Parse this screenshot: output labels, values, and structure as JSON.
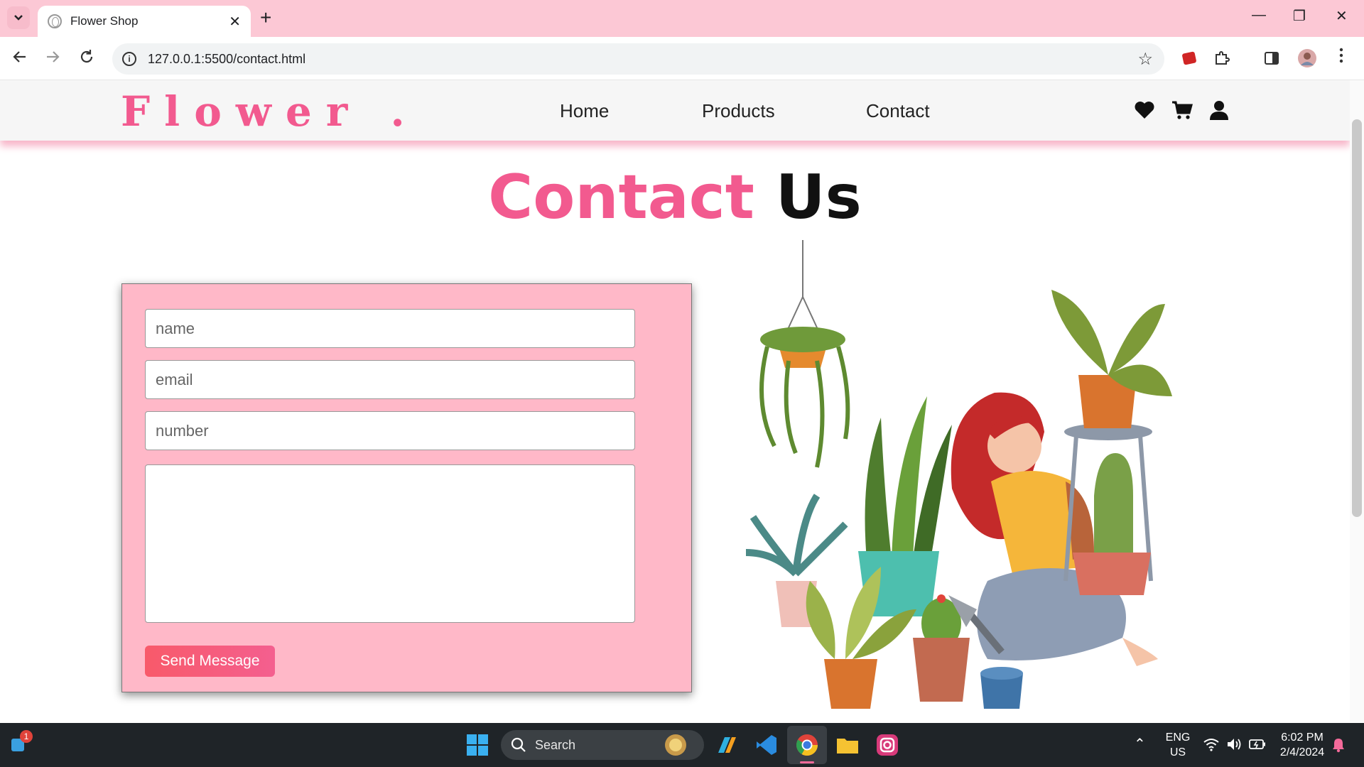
{
  "browser": {
    "tab_title": "Flower Shop",
    "url": "127.0.0.1:5500/contact.html",
    "new_tab_label": "+",
    "tab_close": "✕"
  },
  "site": {
    "logo": "Flower .",
    "nav": [
      "Home",
      "Products",
      "Contact"
    ],
    "accent": "#f25a8f"
  },
  "contact": {
    "heading_accent": "Contact",
    "heading_rest": "Us",
    "name_placeholder": "name",
    "email_placeholder": "email",
    "number_placeholder": "number",
    "message_value": "",
    "send_label": "Send Message"
  },
  "taskbar": {
    "search_label": "Search",
    "lang": "ENG",
    "region": "US",
    "time": "6:02 PM",
    "date": "2/4/2024",
    "notification_count": "1"
  }
}
